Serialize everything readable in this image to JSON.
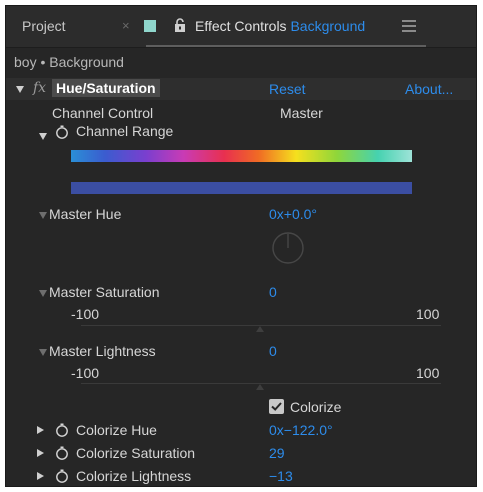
{
  "tabs": {
    "project_label": "Project",
    "close_glyph": "×",
    "effect_prefix": "Effect Controls",
    "effect_layer": "Background",
    "menu_icon": "hamburger-menu-icon",
    "swatch_color": "#8fd6cc"
  },
  "breadcrumb": "boy • Background",
  "effect": {
    "fx_glyph": "fx",
    "name": "Hue/Saturation",
    "reset_label": "Reset",
    "about_label": "About..."
  },
  "properties": {
    "channel_control": {
      "label": "Channel Control",
      "value": "Master"
    },
    "channel_range": {
      "label": "Channel Range"
    },
    "master_hue": {
      "label": "Master Hue",
      "value": "0x+0.0°"
    },
    "master_saturation": {
      "label": "Master Saturation",
      "value": "0",
      "min": "-100",
      "max": "100"
    },
    "master_lightness": {
      "label": "Master Lightness",
      "value": "0",
      "min": "-100",
      "max": "100"
    },
    "colorize": {
      "label": "Colorize",
      "checked": true
    },
    "colorize_hue": {
      "label": "Colorize Hue",
      "value": "0x−122.0°"
    },
    "colorize_saturation": {
      "label": "Colorize Saturation",
      "value": "29"
    },
    "colorize_lightness": {
      "label": "Colorize Lightness",
      "value": "−13"
    }
  },
  "colors": {
    "accent": "#2d8ceb",
    "panel_bg": "#262626",
    "channel_range_bar": "#3b4ea2"
  }
}
